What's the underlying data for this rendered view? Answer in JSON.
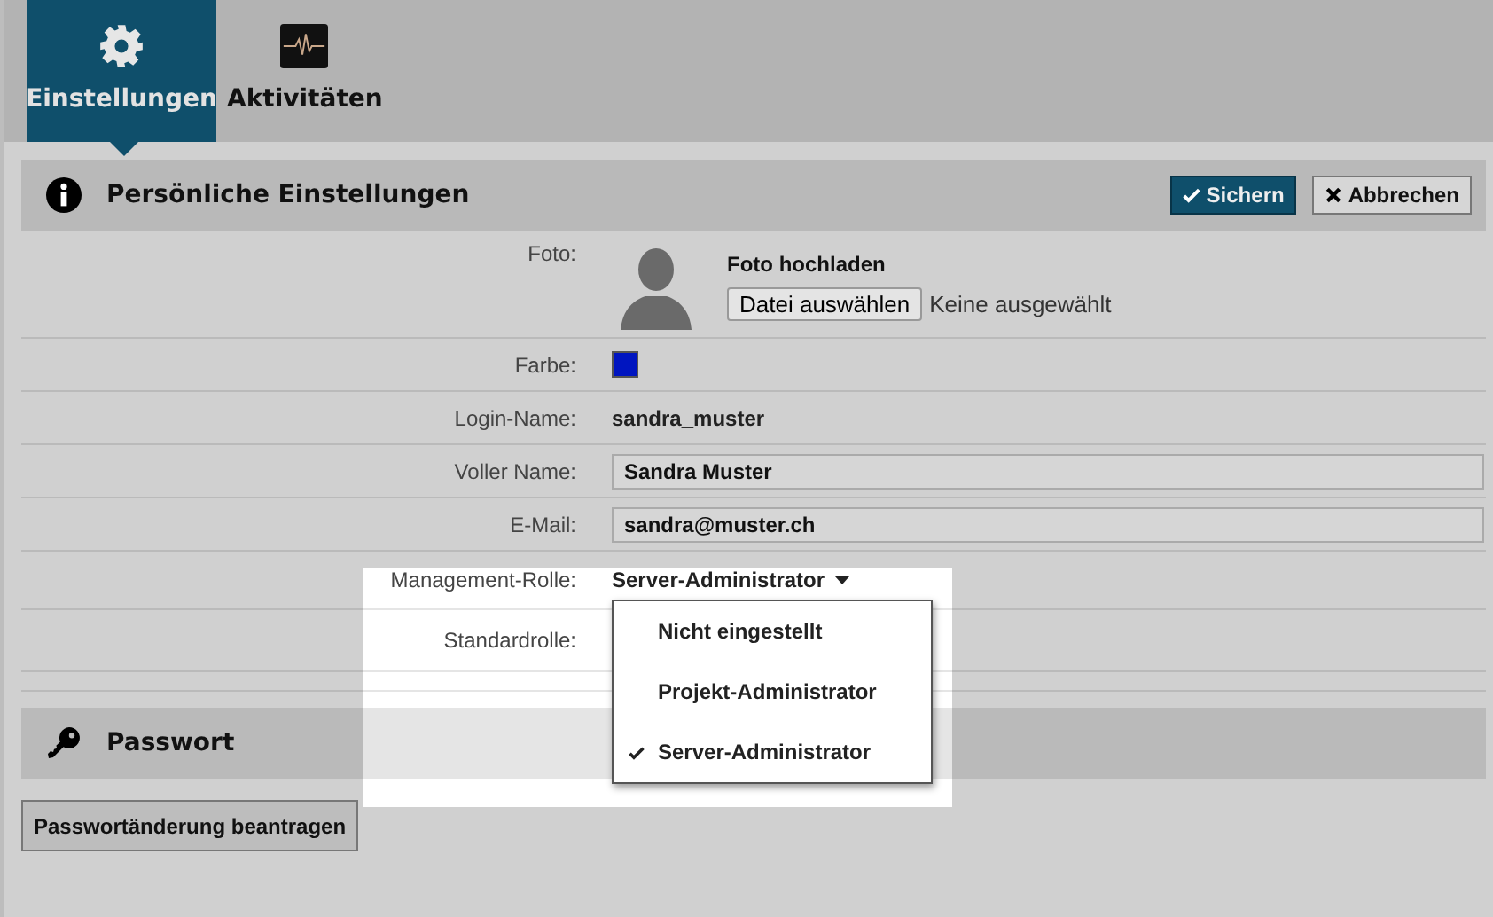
{
  "tabs": [
    {
      "label": "Einstellungen",
      "selected": true
    },
    {
      "label": "Aktivitäten",
      "selected": false
    }
  ],
  "personal": {
    "title": "Persönliche Einstellungen",
    "buttons": [
      {
        "kind": "primary",
        "label": "Sichern"
      },
      {
        "kind": "secondary",
        "label": "Abbrechen"
      }
    ],
    "fields": [
      {
        "kind": "photo",
        "label": "Foto:",
        "title": "Foto hochladen",
        "button": "Datei auswählen",
        "status": "Keine ausgewählt"
      },
      {
        "kind": "color",
        "label": "Farbe:",
        "color": "#0015c0"
      },
      {
        "kind": "text",
        "label": "Login-Name:",
        "value": "sandra_muster"
      },
      {
        "kind": "input",
        "label": "Voller Name:",
        "value": "Sandra Muster"
      },
      {
        "kind": "input",
        "label": "E-Mail:",
        "value": "sandra@muster.ch"
      },
      {
        "kind": "select",
        "label": "Management-Rolle:",
        "value": "Server-Administrator",
        "expanded": true,
        "options": [
          {
            "label": "Nicht eingestellt",
            "selected": false
          },
          {
            "label": "Projekt-Administrator",
            "selected": false
          },
          {
            "label": "Server-Administrator",
            "selected": true
          }
        ]
      },
      {
        "kind": "empty",
        "label": "Standardrolle:"
      }
    ]
  },
  "password": {
    "title": "Passwort",
    "button": "Passwortänderung beantragen"
  }
}
